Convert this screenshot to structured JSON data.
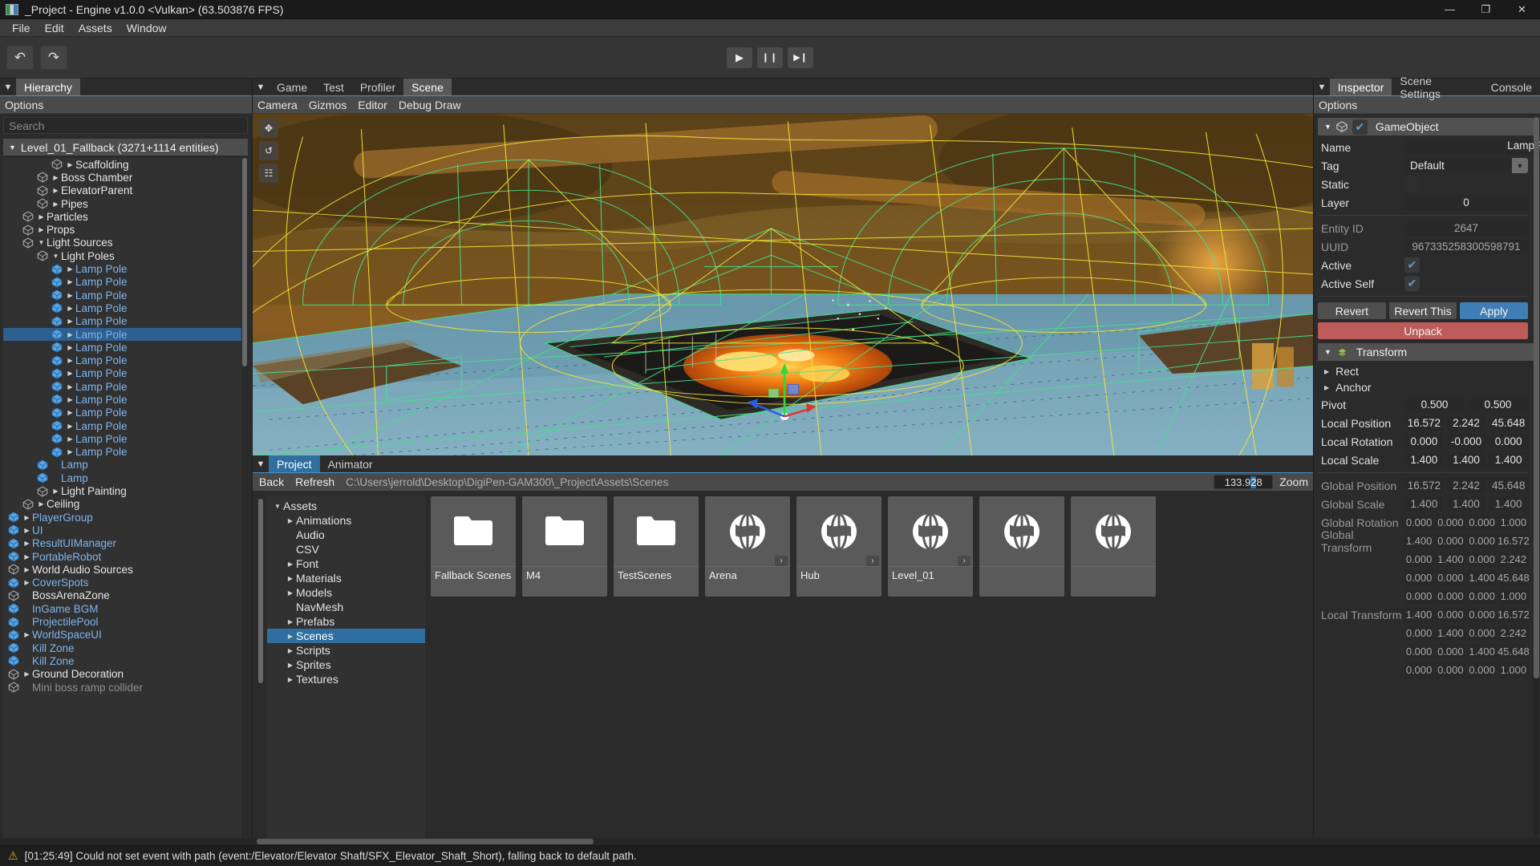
{
  "window": {
    "title": "_Project - Engine v1.0.0 <Vulkan> (63.503876 FPS)",
    "minimize": "—",
    "maximize": "❐",
    "close": "✕"
  },
  "menubar": {
    "items": [
      "File",
      "Edit",
      "Assets",
      "Window"
    ]
  },
  "toolbar": {
    "undo": "↶",
    "redo": "↷",
    "play": "▶",
    "pause": "❙❙",
    "step": "▶❙"
  },
  "hierarchy": {
    "tab": "Hierarchy",
    "options": "Options",
    "search_placeholder": "Search",
    "root": "Level_01_Fallback (3271+1114 entities)",
    "items": [
      {
        "label": "Scaffolding",
        "indent": 3,
        "arrow": true,
        "color": "white"
      },
      {
        "label": "Boss Chamber",
        "indent": 2,
        "arrow": true,
        "color": "white"
      },
      {
        "label": "ElevatorParent",
        "indent": 2,
        "arrow": true,
        "color": "white"
      },
      {
        "label": "Pipes",
        "indent": 2,
        "arrow": true,
        "color": "white"
      },
      {
        "label": "Particles",
        "indent": 1,
        "arrow": true,
        "color": "white"
      },
      {
        "label": "Props",
        "indent": 1,
        "arrow": true,
        "color": "white"
      },
      {
        "label": "Light Sources",
        "indent": 1,
        "arrow": "down",
        "color": "white"
      },
      {
        "label": "Light Poles",
        "indent": 2,
        "arrow": "down",
        "color": "white"
      },
      {
        "label": "Lamp Pole",
        "indent": 3,
        "arrow": true,
        "color": "blue"
      },
      {
        "label": "Lamp Pole",
        "indent": 3,
        "arrow": true,
        "color": "blue"
      },
      {
        "label": "Lamp Pole",
        "indent": 3,
        "arrow": true,
        "color": "blue"
      },
      {
        "label": "Lamp Pole",
        "indent": 3,
        "arrow": true,
        "color": "blue"
      },
      {
        "label": "Lamp Pole",
        "indent": 3,
        "arrow": true,
        "color": "blue"
      },
      {
        "label": "Lamp Pole",
        "indent": 3,
        "arrow": true,
        "color": "blue",
        "selected": true
      },
      {
        "label": "Lamp Pole",
        "indent": 3,
        "arrow": true,
        "color": "blue"
      },
      {
        "label": "Lamp Pole",
        "indent": 3,
        "arrow": true,
        "color": "blue"
      },
      {
        "label": "Lamp Pole",
        "indent": 3,
        "arrow": true,
        "color": "blue"
      },
      {
        "label": "Lamp Pole",
        "indent": 3,
        "arrow": true,
        "color": "blue"
      },
      {
        "label": "Lamp Pole",
        "indent": 3,
        "arrow": true,
        "color": "blue"
      },
      {
        "label": "Lamp Pole",
        "indent": 3,
        "arrow": true,
        "color": "blue"
      },
      {
        "label": "Lamp Pole",
        "indent": 3,
        "arrow": true,
        "color": "blue"
      },
      {
        "label": "Lamp Pole",
        "indent": 3,
        "arrow": true,
        "color": "blue"
      },
      {
        "label": "Lamp Pole",
        "indent": 3,
        "arrow": true,
        "color": "blue"
      },
      {
        "label": "Lamp",
        "indent": 2,
        "arrow": false,
        "color": "blue"
      },
      {
        "label": "Lamp",
        "indent": 2,
        "arrow": false,
        "color": "blue"
      },
      {
        "label": "Light Painting",
        "indent": 2,
        "arrow": true,
        "color": "white"
      },
      {
        "label": "Ceiling",
        "indent": 1,
        "arrow": true,
        "color": "white"
      },
      {
        "label": "PlayerGroup",
        "indent": 0,
        "arrow": true,
        "color": "blue"
      },
      {
        "label": "UI",
        "indent": 0,
        "arrow": true,
        "color": "blue"
      },
      {
        "label": "ResultUIManager",
        "indent": 0,
        "arrow": true,
        "color": "blue"
      },
      {
        "label": "PortableRobot",
        "indent": 0,
        "arrow": true,
        "color": "blue"
      },
      {
        "label": "World Audio Sources",
        "indent": 0,
        "arrow": true,
        "color": "white"
      },
      {
        "label": "CoverSpots",
        "indent": 0,
        "arrow": true,
        "color": "blue"
      },
      {
        "label": "BossArenaZone",
        "indent": 0,
        "arrow": false,
        "color": "white"
      },
      {
        "label": "InGame BGM",
        "indent": 0,
        "arrow": false,
        "color": "blue"
      },
      {
        "label": "ProjectilePool",
        "indent": 0,
        "arrow": false,
        "color": "blue"
      },
      {
        "label": "WorldSpaceUI",
        "indent": 0,
        "arrow": true,
        "color": "blue"
      },
      {
        "label": "Kill Zone",
        "indent": 0,
        "arrow": false,
        "color": "blue"
      },
      {
        "label": "Kill Zone",
        "indent": 0,
        "arrow": false,
        "color": "blue"
      },
      {
        "label": "Ground Decoration",
        "indent": 0,
        "arrow": true,
        "color": "white"
      },
      {
        "label": "Mini boss ramp collider",
        "indent": 0,
        "arrow": false,
        "color": "gray"
      }
    ]
  },
  "scene": {
    "tabs": [
      "Game",
      "Test",
      "Profiler",
      "Scene"
    ],
    "active_tab": "Scene",
    "subbar": [
      "Camera",
      "Gizmos",
      "Editor",
      "Debug Draw"
    ],
    "gizmos": [
      "move-gizmo",
      "rotate-gizmo",
      "scale-gizmo"
    ]
  },
  "project": {
    "tabs": [
      "Project",
      "Animator"
    ],
    "active_tab": "Project",
    "back": "Back",
    "refresh": "Refresh",
    "path": "C:\\Users\\jerrold\\Desktop\\DigiPen-GAM300\\_Project\\Assets\\Scenes",
    "zoom_value_pre": "133.9",
    "zoom_value_sel": "2",
    "zoom_value_post": "8",
    "zoom_label": "Zoom",
    "folders": [
      {
        "label": "Assets",
        "indent": 0,
        "arrow": "down"
      },
      {
        "label": "Animations",
        "indent": 1,
        "arrow": true
      },
      {
        "label": "Audio",
        "indent": 1,
        "arrow": false
      },
      {
        "label": "CSV",
        "indent": 1,
        "arrow": false
      },
      {
        "label": "Font",
        "indent": 1,
        "arrow": true
      },
      {
        "label": "Materials",
        "indent": 1,
        "arrow": true
      },
      {
        "label": "Models",
        "indent": 1,
        "arrow": true
      },
      {
        "label": "NavMesh",
        "indent": 1,
        "arrow": false
      },
      {
        "label": "Prefabs",
        "indent": 1,
        "arrow": true
      },
      {
        "label": "Scenes",
        "indent": 1,
        "arrow": true,
        "selected": true
      },
      {
        "label": "Scripts",
        "indent": 1,
        "arrow": true
      },
      {
        "label": "Sprites",
        "indent": 1,
        "arrow": true
      },
      {
        "label": "Textures",
        "indent": 1,
        "arrow": true
      }
    ],
    "assets": [
      {
        "label": "Fallback Scenes",
        "icon": "folder-icon",
        "expand": false
      },
      {
        "label": "M4",
        "icon": "folder-icon",
        "expand": false
      },
      {
        "label": "TestScenes",
        "icon": "folder-icon",
        "expand": false
      },
      {
        "label": "Arena",
        "icon": "scene-globe-icon",
        "expand": true
      },
      {
        "label": "Hub",
        "icon": "scene-globe-icon",
        "expand": true
      },
      {
        "label": "Level_01",
        "icon": "scene-globe-icon",
        "expand": true
      },
      {
        "label": "",
        "icon": "scene-globe-icon",
        "expand": false
      },
      {
        "label": "",
        "icon": "scene-globe-icon",
        "expand": false
      }
    ]
  },
  "inspector": {
    "tabs": [
      "Inspector",
      "Scene Settings",
      "Console"
    ],
    "active_tab": "Inspector",
    "options": "Options",
    "gameobject": {
      "header": "GameObject",
      "name_label": "Name",
      "name_value": "Lamp Pole",
      "tag_label": "Tag",
      "tag_value": "Default",
      "static_label": "Static",
      "static_checked": false,
      "layer_label": "Layer",
      "layer_value": "0",
      "entity_id_label": "Entity ID",
      "entity_id_value": "2647",
      "uuid_label": "UUID",
      "uuid_value": "967335258300598791",
      "active_label": "Active",
      "active_checked": true,
      "active_self_label": "Active Self",
      "active_self_checked": true,
      "revert": "Revert",
      "revert_this": "Revert This",
      "apply": "Apply",
      "unpack": "Unpack"
    },
    "transform": {
      "header": "Transform",
      "rect": "Rect",
      "anchor": "Anchor",
      "pivot_label": "Pivot",
      "pivot": [
        "0.500",
        "0.500"
      ],
      "local_position_label": "Local Position",
      "local_position": [
        "16.572",
        "2.242",
        "45.648"
      ],
      "local_rotation_label": "Local Rotation",
      "local_rotation": [
        "0.000",
        "-0.000",
        "0.000"
      ],
      "local_scale_label": "Local Scale",
      "local_scale": [
        "1.400",
        "1.400",
        "1.400"
      ],
      "global_position_label": "Global Position",
      "global_position": [
        "16.572",
        "2.242",
        "45.648"
      ],
      "global_scale_label": "Global Scale",
      "global_scale": [
        "1.400",
        "1.400",
        "1.400"
      ],
      "global_rotation_label": "Global Rotation",
      "global_rotation": [
        "0.000",
        "0.000",
        "0.000",
        "1.000"
      ],
      "global_transform_label": "Global Transform",
      "global_transform": [
        [
          "1.400",
          "0.000",
          "0.000",
          "16.572"
        ],
        [
          "0.000",
          "1.400",
          "0.000",
          "2.242"
        ],
        [
          "0.000",
          "0.000",
          "1.400",
          "45.648"
        ],
        [
          "0.000",
          "0.000",
          "0.000",
          "1.000"
        ]
      ],
      "local_transform_label": "Local Transform",
      "local_transform": [
        [
          "1.400",
          "0.000",
          "0.000",
          "16.572"
        ],
        [
          "0.000",
          "1.400",
          "0.000",
          "2.242"
        ],
        [
          "0.000",
          "0.000",
          "1.400",
          "45.648"
        ],
        [
          "0.000",
          "0.000",
          "0.000",
          "1.000"
        ]
      ]
    }
  },
  "status": {
    "warning_icon": "⚠",
    "message": "[01:25:49] Could not set event with path (event:/Elevator/Elevator Shaft/SFX_Elevator_Shaft_Short), falling back to default path."
  },
  "colors": {
    "accent_blue": "#2f6f9f",
    "selection_blue": "#2d5f8f",
    "link_blue": "#7fb4ec",
    "apply_blue": "#3f7fb5",
    "danger_red": "#bd5a5a",
    "warning_yellow": "#e8b020"
  }
}
